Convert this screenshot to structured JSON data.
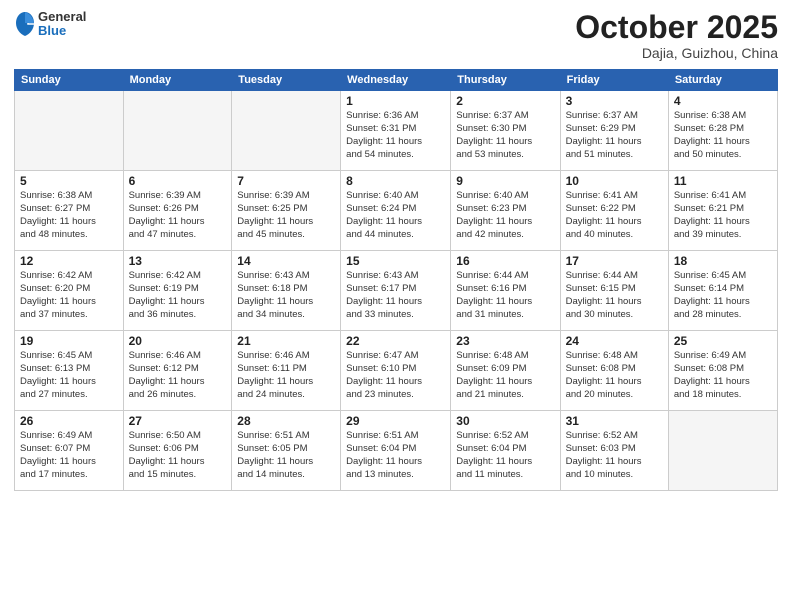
{
  "header": {
    "logo": {
      "general": "General",
      "blue": "Blue"
    },
    "title": "October 2025",
    "location": "Dajia, Guizhou, China"
  },
  "weekdays": [
    "Sunday",
    "Monday",
    "Tuesday",
    "Wednesday",
    "Thursday",
    "Friday",
    "Saturday"
  ],
  "weeks": [
    [
      {
        "day": "",
        "info": ""
      },
      {
        "day": "",
        "info": ""
      },
      {
        "day": "",
        "info": ""
      },
      {
        "day": "1",
        "info": "Sunrise: 6:36 AM\nSunset: 6:31 PM\nDaylight: 11 hours\nand 54 minutes."
      },
      {
        "day": "2",
        "info": "Sunrise: 6:37 AM\nSunset: 6:30 PM\nDaylight: 11 hours\nand 53 minutes."
      },
      {
        "day": "3",
        "info": "Sunrise: 6:37 AM\nSunset: 6:29 PM\nDaylight: 11 hours\nand 51 minutes."
      },
      {
        "day": "4",
        "info": "Sunrise: 6:38 AM\nSunset: 6:28 PM\nDaylight: 11 hours\nand 50 minutes."
      }
    ],
    [
      {
        "day": "5",
        "info": "Sunrise: 6:38 AM\nSunset: 6:27 PM\nDaylight: 11 hours\nand 48 minutes."
      },
      {
        "day": "6",
        "info": "Sunrise: 6:39 AM\nSunset: 6:26 PM\nDaylight: 11 hours\nand 47 minutes."
      },
      {
        "day": "7",
        "info": "Sunrise: 6:39 AM\nSunset: 6:25 PM\nDaylight: 11 hours\nand 45 minutes."
      },
      {
        "day": "8",
        "info": "Sunrise: 6:40 AM\nSunset: 6:24 PM\nDaylight: 11 hours\nand 44 minutes."
      },
      {
        "day": "9",
        "info": "Sunrise: 6:40 AM\nSunset: 6:23 PM\nDaylight: 11 hours\nand 42 minutes."
      },
      {
        "day": "10",
        "info": "Sunrise: 6:41 AM\nSunset: 6:22 PM\nDaylight: 11 hours\nand 40 minutes."
      },
      {
        "day": "11",
        "info": "Sunrise: 6:41 AM\nSunset: 6:21 PM\nDaylight: 11 hours\nand 39 minutes."
      }
    ],
    [
      {
        "day": "12",
        "info": "Sunrise: 6:42 AM\nSunset: 6:20 PM\nDaylight: 11 hours\nand 37 minutes."
      },
      {
        "day": "13",
        "info": "Sunrise: 6:42 AM\nSunset: 6:19 PM\nDaylight: 11 hours\nand 36 minutes."
      },
      {
        "day": "14",
        "info": "Sunrise: 6:43 AM\nSunset: 6:18 PM\nDaylight: 11 hours\nand 34 minutes."
      },
      {
        "day": "15",
        "info": "Sunrise: 6:43 AM\nSunset: 6:17 PM\nDaylight: 11 hours\nand 33 minutes."
      },
      {
        "day": "16",
        "info": "Sunrise: 6:44 AM\nSunset: 6:16 PM\nDaylight: 11 hours\nand 31 minutes."
      },
      {
        "day": "17",
        "info": "Sunrise: 6:44 AM\nSunset: 6:15 PM\nDaylight: 11 hours\nand 30 minutes."
      },
      {
        "day": "18",
        "info": "Sunrise: 6:45 AM\nSunset: 6:14 PM\nDaylight: 11 hours\nand 28 minutes."
      }
    ],
    [
      {
        "day": "19",
        "info": "Sunrise: 6:45 AM\nSunset: 6:13 PM\nDaylight: 11 hours\nand 27 minutes."
      },
      {
        "day": "20",
        "info": "Sunrise: 6:46 AM\nSunset: 6:12 PM\nDaylight: 11 hours\nand 26 minutes."
      },
      {
        "day": "21",
        "info": "Sunrise: 6:46 AM\nSunset: 6:11 PM\nDaylight: 11 hours\nand 24 minutes."
      },
      {
        "day": "22",
        "info": "Sunrise: 6:47 AM\nSunset: 6:10 PM\nDaylight: 11 hours\nand 23 minutes."
      },
      {
        "day": "23",
        "info": "Sunrise: 6:48 AM\nSunset: 6:09 PM\nDaylight: 11 hours\nand 21 minutes."
      },
      {
        "day": "24",
        "info": "Sunrise: 6:48 AM\nSunset: 6:08 PM\nDaylight: 11 hours\nand 20 minutes."
      },
      {
        "day": "25",
        "info": "Sunrise: 6:49 AM\nSunset: 6:08 PM\nDaylight: 11 hours\nand 18 minutes."
      }
    ],
    [
      {
        "day": "26",
        "info": "Sunrise: 6:49 AM\nSunset: 6:07 PM\nDaylight: 11 hours\nand 17 minutes."
      },
      {
        "day": "27",
        "info": "Sunrise: 6:50 AM\nSunset: 6:06 PM\nDaylight: 11 hours\nand 15 minutes."
      },
      {
        "day": "28",
        "info": "Sunrise: 6:51 AM\nSunset: 6:05 PM\nDaylight: 11 hours\nand 14 minutes."
      },
      {
        "day": "29",
        "info": "Sunrise: 6:51 AM\nSunset: 6:04 PM\nDaylight: 11 hours\nand 13 minutes."
      },
      {
        "day": "30",
        "info": "Sunrise: 6:52 AM\nSunset: 6:04 PM\nDaylight: 11 hours\nand 11 minutes."
      },
      {
        "day": "31",
        "info": "Sunrise: 6:52 AM\nSunset: 6:03 PM\nDaylight: 11 hours\nand 10 minutes."
      },
      {
        "day": "",
        "info": ""
      }
    ]
  ]
}
